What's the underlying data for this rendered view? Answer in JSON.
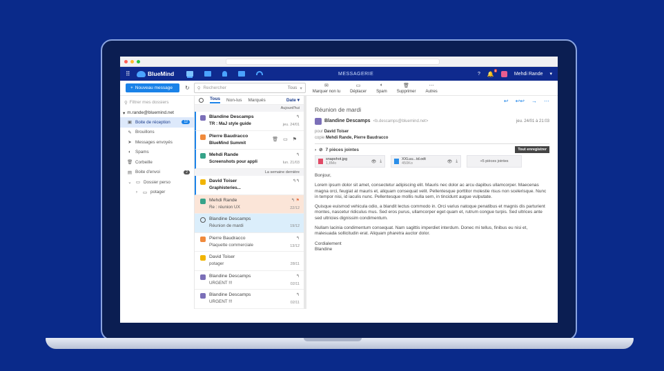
{
  "app": {
    "name": "BlueMind",
    "title": "MESSAGERIE",
    "help": "?",
    "notif_count": "8",
    "user": "Mehdi Rande"
  },
  "toolbar": {
    "new_message": "Nouveau message",
    "search_placeholder": "Rechercher",
    "search_scope": "Tous",
    "actions": [
      {
        "label": "Marquer non lu",
        "icon": "mark-unread-icon"
      },
      {
        "label": "Déplacer",
        "icon": "move-icon"
      },
      {
        "label": "Spam",
        "icon": "spam-icon"
      },
      {
        "label": "Supprimer",
        "icon": "trash-icon"
      },
      {
        "label": "Autres",
        "icon": "more-icon"
      }
    ]
  },
  "sidebar": {
    "filter_placeholder": "Filtrer mes dossiers",
    "account": "m.rande@bluemind.net",
    "folders": [
      {
        "label": "Boite de réception",
        "badge": "12"
      },
      {
        "label": "Brouillons",
        "badge": ""
      },
      {
        "label": "Messages envoyés",
        "badge": ""
      },
      {
        "label": "Spams",
        "badge": ""
      },
      {
        "label": "Corbeille",
        "badge": ""
      },
      {
        "label": "Boite d'envoi",
        "badge": "2"
      },
      {
        "label": "Dossier perso",
        "badge": ""
      },
      {
        "label": "potager",
        "badge": ""
      }
    ]
  },
  "list": {
    "tabs": [
      "Tous",
      "Non-lus",
      "Marqués"
    ],
    "sort": "Date",
    "sep_today": "Aujourd'hui",
    "sep_week": "La semaine dernière",
    "messages": [
      {
        "sender": "Blandine Descamps",
        "subject": "TR : MaJ style guide",
        "date": "jeu. 24/01",
        "color": "#7b6fb8"
      },
      {
        "sender": "Pierre Baudracco",
        "subject": "BlueMind Summit",
        "date": "",
        "color": "#f08a3c"
      },
      {
        "sender": "Mehdi Rande",
        "subject": "Screenshots pour appli",
        "date": "lun. 21/03",
        "color": "#36a389"
      },
      {
        "sender": "David Toiser",
        "subject": "Graphisteries...",
        "date": "",
        "color": "#f1b400"
      },
      {
        "sender": "Mehdi Rande",
        "subject": "Re : réunion UX",
        "date": "22/12",
        "color": "#36a389"
      },
      {
        "sender": "Blandine Descamps",
        "subject": "Réunion de mardi",
        "date": "19/12",
        "color": "#7b6fb8"
      },
      {
        "sender": "Pierre Baudracco",
        "subject": "Plaquette commerciale",
        "date": "13/12",
        "color": "#f08a3c"
      },
      {
        "sender": "David Toiser",
        "subject": "potager",
        "date": "28/11",
        "color": "#f1b400"
      },
      {
        "sender": "Blandine Descamps",
        "subject": "URGENT !!!",
        "date": "02/11",
        "color": "#7b6fb8"
      },
      {
        "sender": "Blandine Descamps",
        "subject": "URGENT !!!",
        "date": "02/11",
        "color": "#7b6fb8"
      }
    ]
  },
  "reader": {
    "subject": "Réunion de mardi",
    "from_name": "Blandine Descamps",
    "from_mail": "<b.descamps@bluemind.net>",
    "date": "jeu. 24/01 à 21:03",
    "to_label": "pour",
    "to": "David Toiser",
    "cc_label": "copie",
    "cc": "Mehdi Rande, Pierre Baudracco",
    "attachments_label": "7 pièces jointes",
    "save_all": "Tout enregistrer",
    "attachments": [
      {
        "name": "snapshot.jpg",
        "size": "1,8Mo",
        "color": "#e04a66"
      },
      {
        "name": "XXLuu...td.odt",
        "size": "450Ko",
        "color": "#2a8ee8"
      }
    ],
    "more_attachments": "+5 pièces jointes",
    "greeting": "Bonjour,",
    "paragraphs": [
      "Lorem ipsum dolor sit amet, consectetur adipiscing elit. Mauris nec dolor ac arcu dapibus ullamcorper. Maecenas magna orci, feugiat at mauris et, aliquam consequat velit. Pellentesque porttitor molestie risus non scelerisque. Nunc in tempor nisi, id iaculis nunc. Pellentesque mollis nulla sem, in tincidunt augue vulputate.",
      "Quisque euismod vehicula odio, a blandit lectus commodo in. Orci varius natoque penatibus et magnis dis parturient montes, nascetur ridiculus mus. Sed eros purus, ullamcorper eget quam et, rutrum congue turpis. Sed ultrices ante sed ultricies dignissim condimentum.",
      "Nullam lacinia condimentum consequat. Nam sagittis imperdiet interdum. Donec mi tellus, finibus eu nisi et, malesuada sollicitudin erat. Aliquam pharetra auctor dolor."
    ],
    "sign_1": "Cordialement",
    "sign_2": "Blandine"
  }
}
